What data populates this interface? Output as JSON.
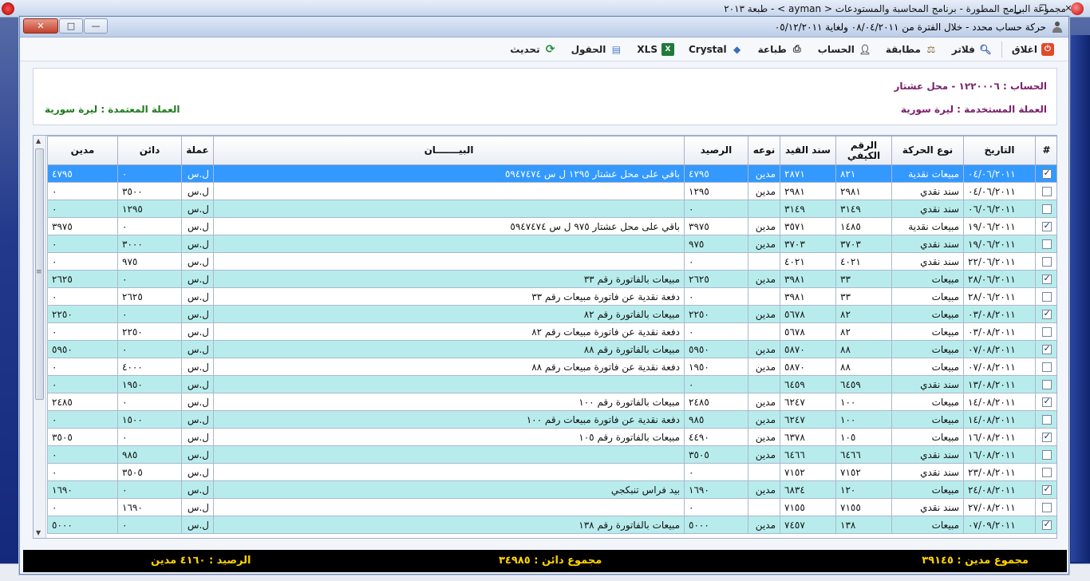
{
  "app": {
    "title": "مجموعة البرامج المطورة - برنامج المحاسبة والمستودعات < ayman > - طبعة ٢٠١٣"
  },
  "window": {
    "title": "حركة حساب محدد - خلال الفترة من ٠٨/٠٤/٢٠١١ ولغاية ٠٥/١٢/٢٠١١"
  },
  "toolbar": {
    "close_label": "اغلاق",
    "filters_label": "فلاتر",
    "match_label": "مطابقة",
    "account_label": "الحساب",
    "print_label": "طباعة",
    "crystal_label": "Crystal",
    "xls_label": "XLS",
    "fields_label": "الحقول",
    "refresh_label": "تحديث"
  },
  "info": {
    "account": "الحساب : ١٢٢٠٠٠٦ - محل عشتار",
    "used_currency": "العملة المستخدمة : ليرة سورية",
    "base_currency": "العملة المعتمدة : ليرة سورية"
  },
  "table": {
    "headers": {
      "num": "#",
      "date": "التاريخ",
      "movement_type": "نوع الحركة",
      "record_no": "الرقم الكيفي",
      "entry_no": "سند القيد",
      "kind": "نوعه",
      "balance": "الرصيد",
      "description": "البيـــــــان",
      "currency": "عملة",
      "credit": "دائن",
      "debit": "مدين"
    },
    "rows": [
      {
        "checked": true,
        "date": "٠٤/٠٦/٢٠١١",
        "type": "مبيعات نقدية",
        "rec": "٨٢١",
        "entry": "٢٨٧١",
        "kind": "مدين",
        "balance": "٤٧٩٥",
        "desc": "باقي على محل عشتار ١٢٩٥ ل س ٥٩٤٧٤٧٤",
        "cur": "ل.س",
        "credit": "٠",
        "debit": "٤٧٩٥"
      },
      {
        "checked": false,
        "date": "٠٤/٠٦/٢٠١١",
        "type": "سند نقدي",
        "rec": "٢٩٨١",
        "entry": "٢٩٨١",
        "kind": "مدين",
        "balance": "١٢٩٥",
        "desc": "",
        "cur": "ل.س",
        "credit": "٣٥٠٠",
        "debit": "٠"
      },
      {
        "checked": false,
        "date": "٠٦/٠٦/٢٠١١",
        "type": "سند نقدي",
        "rec": "٣١٤٩",
        "entry": "٣١٤٩",
        "kind": "",
        "balance": "٠",
        "desc": "",
        "cur": "ل.س",
        "credit": "١٢٩٥",
        "debit": "٠"
      },
      {
        "checked": true,
        "date": "١٩/٠٦/٢٠١١",
        "type": "مبيعات نقدية",
        "rec": "١٤٨٥",
        "entry": "٣٥٧١",
        "kind": "مدين",
        "balance": "٣٩٧٥",
        "desc": "باقي على محل عشتار ٩٧٥ ل س ٥٩٤٧٤٧٤",
        "cur": "ل.س",
        "credit": "٠",
        "debit": "٣٩٧٥"
      },
      {
        "checked": false,
        "date": "١٩/٠٦/٢٠١١",
        "type": "سند نقدي",
        "rec": "٣٧٠٣",
        "entry": "٣٧٠٣",
        "kind": "مدين",
        "balance": "٩٧٥",
        "desc": "",
        "cur": "ل.س",
        "credit": "٣٠٠٠",
        "debit": "٠"
      },
      {
        "checked": false,
        "date": "٢٢/٠٦/٢٠١١",
        "type": "سند نقدي",
        "rec": "٤٠٢١",
        "entry": "٤٠٢١",
        "kind": "",
        "balance": "٠",
        "desc": "",
        "cur": "ل.س",
        "credit": "٩٧٥",
        "debit": "٠"
      },
      {
        "checked": true,
        "date": "٢٨/٠٦/٢٠١١",
        "type": "مبيعات",
        "rec": "٣٣",
        "entry": "٣٩٨١",
        "kind": "مدين",
        "balance": "٢٦٢٥",
        "desc": "مبيعات بالفاتورة رقم ٣٣",
        "cur": "ل.س",
        "credit": "٠",
        "debit": "٢٦٢٥"
      },
      {
        "checked": false,
        "date": "٢٨/٠٦/٢٠١١",
        "type": "مبيعات",
        "rec": "٣٣",
        "entry": "٣٩٨١",
        "kind": "",
        "balance": "٠",
        "desc": "دفعة نقدية عن فاتورة مبيعات رقم ٣٣",
        "cur": "ل.س",
        "credit": "٢٦٢٥",
        "debit": "٠"
      },
      {
        "checked": true,
        "date": "٠٣/٠٨/٢٠١١",
        "type": "مبيعات",
        "rec": "٨٢",
        "entry": "٥٦٧٨",
        "kind": "مدين",
        "balance": "٢٢٥٠",
        "desc": "مبيعات بالفاتورة رقم ٨٢",
        "cur": "ل.س",
        "credit": "٠",
        "debit": "٢٢٥٠"
      },
      {
        "checked": false,
        "date": "٠٣/٠٨/٢٠١١",
        "type": "مبيعات",
        "rec": "٨٢",
        "entry": "٥٦٧٨",
        "kind": "",
        "balance": "٠",
        "desc": "دفعة نقدية عن فاتورة مبيعات رقم ٨٢",
        "cur": "ل.س",
        "credit": "٢٢٥٠",
        "debit": "٠"
      },
      {
        "checked": true,
        "date": "٠٧/٠٨/٢٠١١",
        "type": "مبيعات",
        "rec": "٨٨",
        "entry": "٥٨٧٠",
        "kind": "مدين",
        "balance": "٥٩٥٠",
        "desc": "مبيعات بالفاتورة رقم ٨٨",
        "cur": "ل.س",
        "credit": "٠",
        "debit": "٥٩٥٠"
      },
      {
        "checked": false,
        "date": "٠٧/٠٨/٢٠١١",
        "type": "مبيعات",
        "rec": "٨٨",
        "entry": "٥٨٧٠",
        "kind": "مدين",
        "balance": "١٩٥٠",
        "desc": "دفعة نقدية عن فاتورة مبيعات رقم ٨٨",
        "cur": "ل.س",
        "credit": "٤٠٠٠",
        "debit": "٠"
      },
      {
        "checked": false,
        "date": "١٣/٠٨/٢٠١١",
        "type": "سند نقدي",
        "rec": "٦٤٥٩",
        "entry": "٦٤٥٩",
        "kind": "",
        "balance": "٠",
        "desc": "",
        "cur": "ل.س",
        "credit": "١٩٥٠",
        "debit": "٠"
      },
      {
        "checked": true,
        "date": "١٤/٠٨/٢٠١١",
        "type": "مبيعات",
        "rec": "١٠٠",
        "entry": "٦٢٤٧",
        "kind": "مدين",
        "balance": "٢٤٨٥",
        "desc": "مبيعات بالفاتورة رقم ١٠٠",
        "cur": "ل.س",
        "credit": "٠",
        "debit": "٢٤٨٥"
      },
      {
        "checked": false,
        "date": "١٤/٠٨/٢٠١١",
        "type": "مبيعات",
        "rec": "١٠٠",
        "entry": "٦٢٤٧",
        "kind": "مدين",
        "balance": "٩٨٥",
        "desc": "دفعة نقدية عن فاتورة مبيعات رقم ١٠٠",
        "cur": "ل.س",
        "credit": "١٥٠٠",
        "debit": "٠"
      },
      {
        "checked": true,
        "date": "١٦/٠٨/٢٠١١",
        "type": "مبيعات",
        "rec": "١٠٥",
        "entry": "٦٣٧٨",
        "kind": "مدين",
        "balance": "٤٤٩٠",
        "desc": "مبيعات بالفاتورة رقم ١٠٥",
        "cur": "ل.س",
        "credit": "٠",
        "debit": "٣٥٠٥"
      },
      {
        "checked": false,
        "date": "١٦/٠٨/٢٠١١",
        "type": "سند نقدي",
        "rec": "٦٤٦٦",
        "entry": "٦٤٦٦",
        "kind": "مدين",
        "balance": "٣٥٠٥",
        "desc": "",
        "cur": "ل.س",
        "credit": "٩٨٥",
        "debit": "٠"
      },
      {
        "checked": false,
        "date": "٢٣/٠٨/٢٠١١",
        "type": "سند نقدي",
        "rec": "٧١٥٢",
        "entry": "٧١٥٢",
        "kind": "",
        "balance": "٠",
        "desc": "",
        "cur": "ل.س",
        "credit": "٣٥٠٥",
        "debit": "٠"
      },
      {
        "checked": true,
        "date": "٢٤/٠٨/٢٠١١",
        "type": "مبيعات",
        "rec": "١٢٠",
        "entry": "٦٨٣٤",
        "kind": "مدين",
        "balance": "١٦٩٠",
        "desc": "بيد فراس تنبكجي",
        "cur": "ل.س",
        "credit": "٠",
        "debit": "١٦٩٠"
      },
      {
        "checked": false,
        "date": "٢٧/٠٨/٢٠١١",
        "type": "سند نقدي",
        "rec": "٧١٥٥",
        "entry": "٧١٥٥",
        "kind": "",
        "balance": "٠",
        "desc": "",
        "cur": "ل.س",
        "credit": "١٦٩٠",
        "debit": "٠"
      },
      {
        "checked": true,
        "date": "٠٧/٠٩/٢٠١١",
        "type": "مبيعات",
        "rec": "١٣٨",
        "entry": "٧٤٥٧",
        "kind": "مدين",
        "balance": "٥٠٠٠",
        "desc": "مبيعات بالفاتورة رقم ١٣٨",
        "cur": "ل.س",
        "credit": "٠",
        "debit": "٥٠٠٠"
      }
    ]
  },
  "footer": {
    "sum_debit": "مجموع مدين : ٣٩١٤٥",
    "sum_credit": "مجموع دائن : ٣٤٩٨٥",
    "balance": "الرصيد : ٤١٦٠ مدين"
  }
}
